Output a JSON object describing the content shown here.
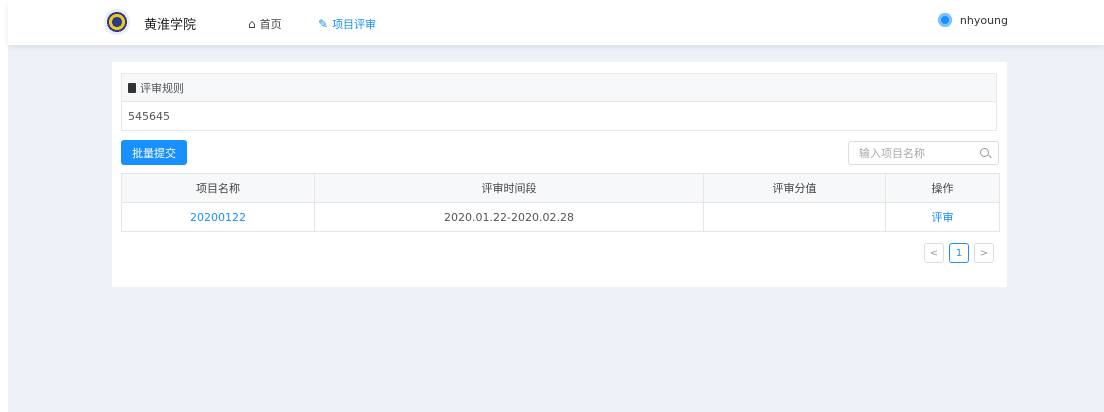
{
  "header": {
    "brand": "黄淮学院",
    "nav": [
      {
        "label": "首页",
        "icon": "home-icon"
      },
      {
        "label": "项目评审",
        "icon": "edit-icon"
      }
    ],
    "username": "nhyoung"
  },
  "rules": {
    "title": "评审规则",
    "content": "545645"
  },
  "toolbar": {
    "batch_submit_label": "批量提交",
    "search_placeholder": "输入项目名称",
    "search_value": ""
  },
  "table": {
    "columns": [
      "项目名称",
      "评审时间段",
      "评审分值",
      "操作"
    ],
    "rows": [
      {
        "name": "20200122",
        "period": "2020.01.22-2020.02.28",
        "score": "",
        "action": "评审"
      }
    ]
  },
  "pagination": {
    "prev": "<",
    "current": "1",
    "next": ">"
  },
  "colors": {
    "accent": "#1890ff",
    "page_bg": "#edf1f8"
  }
}
